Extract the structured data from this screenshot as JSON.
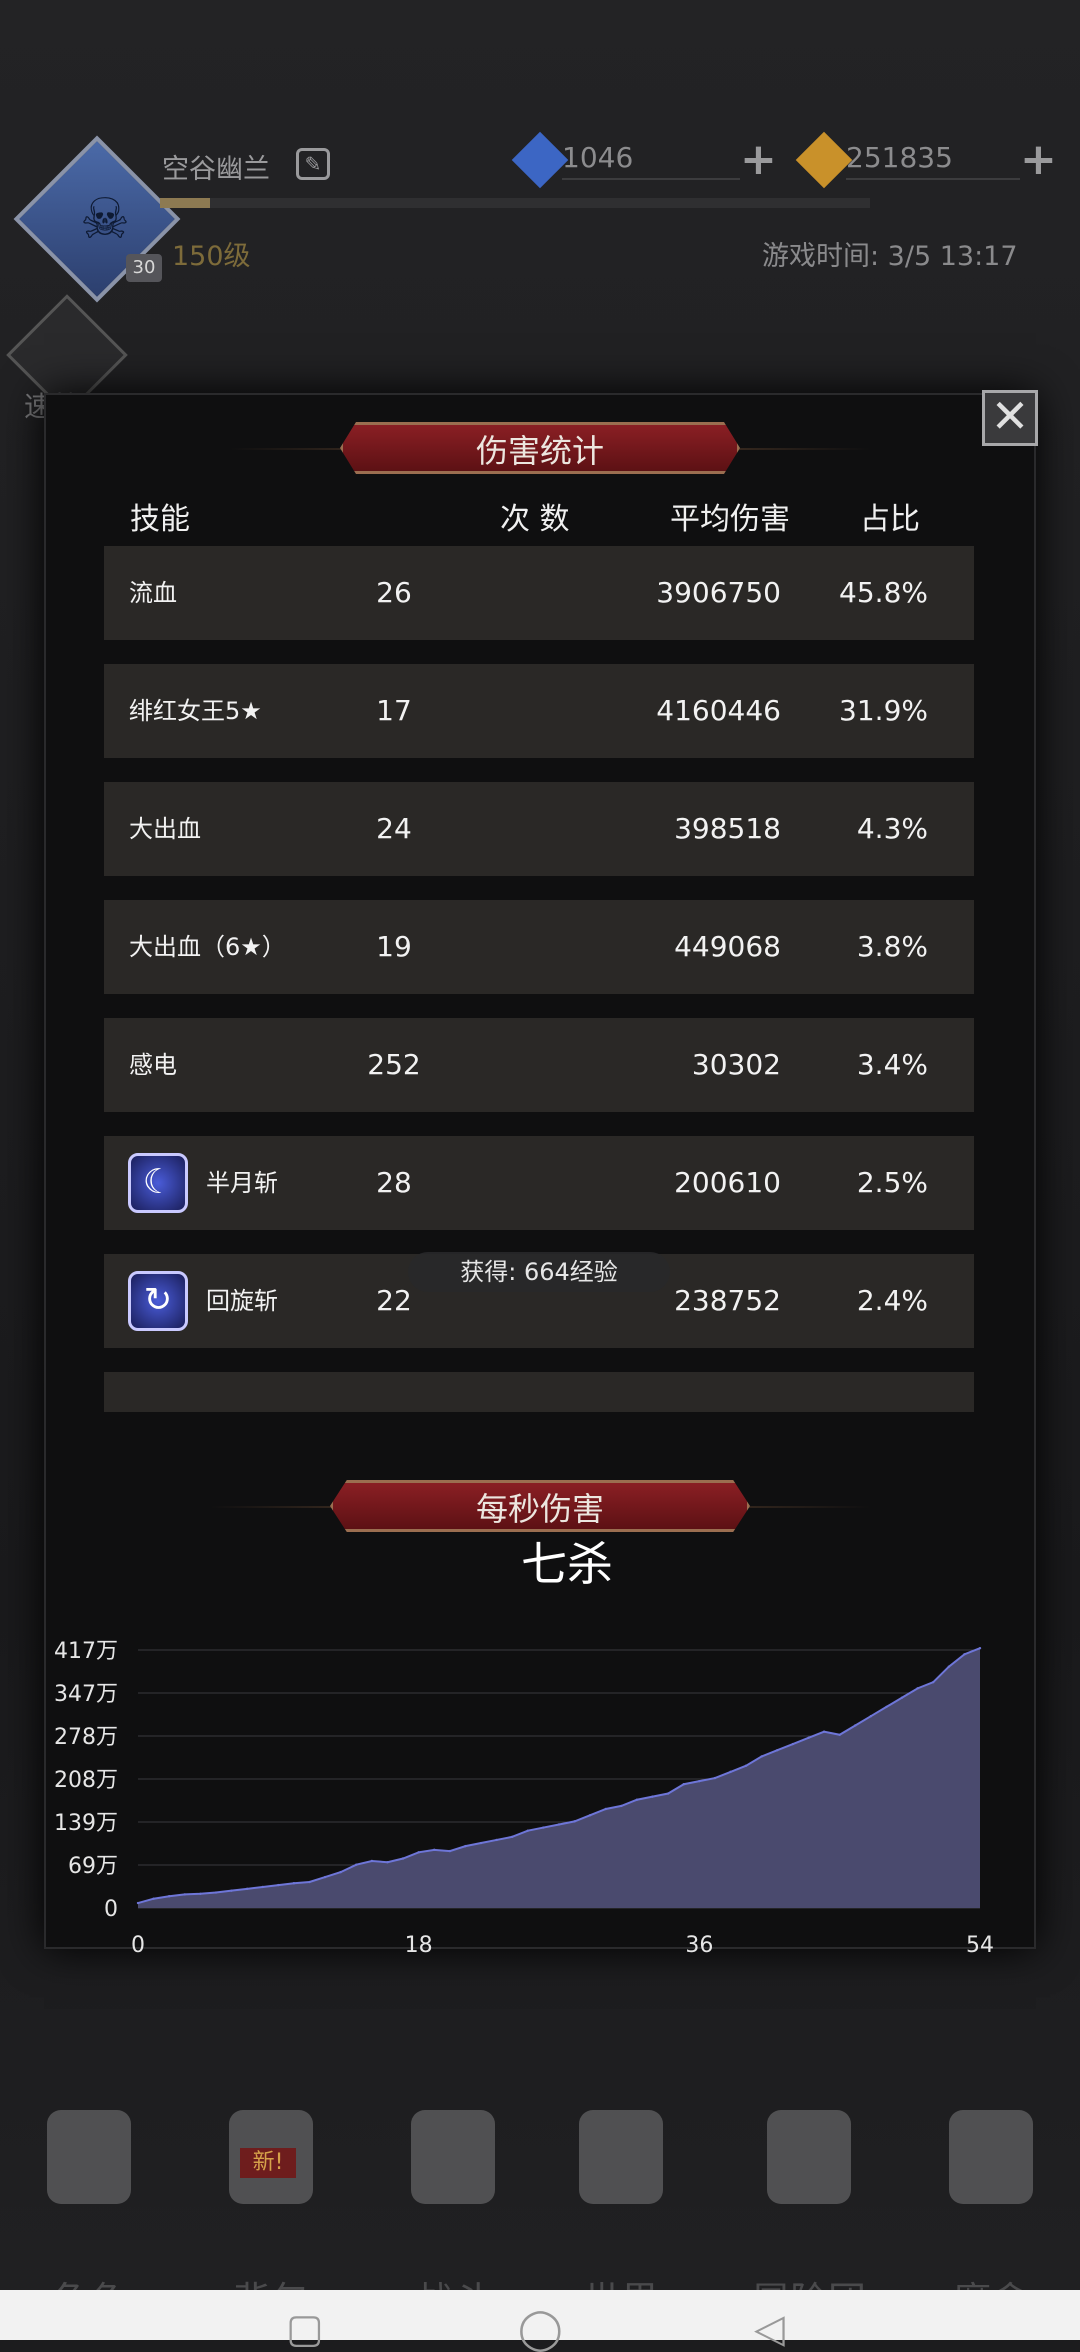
{
  "header": {
    "player_name": "空谷幽兰",
    "player_level": "150级",
    "level_badge": "30",
    "exp_progress": 0.07,
    "gems": "1046",
    "gold": "251835",
    "game_time": "游戏时间: 3/5 13:17",
    "side_label": "速战"
  },
  "modal": {
    "title": "伤害统计",
    "close_icon": "close-icon",
    "columns": {
      "skill": "技能",
      "count": "次 数",
      "avg_damage": "平均伤害",
      "ratio": "占比"
    },
    "rows": [
      {
        "skill": "流血",
        "count": "26",
        "avg": "3906750",
        "pct": "45.8%"
      },
      {
        "skill": "绯红女王5★",
        "count": "17",
        "avg": "4160446",
        "pct": "31.9%"
      },
      {
        "skill": "大出血",
        "count": "24",
        "avg": "398518",
        "pct": "4.3%"
      },
      {
        "skill": "大出血（6★）",
        "count": "19",
        "avg": "449068",
        "pct": "3.8%"
      },
      {
        "skill": "感电",
        "count": "252",
        "avg": "30302",
        "pct": "3.4%"
      },
      {
        "skill": "半月斩",
        "count": "28",
        "avg": "200610",
        "pct": "2.5%",
        "icon": "crescent-moon-icon"
      },
      {
        "skill": "回旋斩",
        "count": "22",
        "avg": "238752",
        "pct": "2.4%",
        "icon": "whirl-slash-icon"
      },
      {
        "skill": "",
        "count": "",
        "avg": "",
        "pct": ""
      }
    ],
    "exp_toast": "获得: 664经验",
    "dps_title": "每秒伤害",
    "chart_title": "七杀"
  },
  "chart_data": {
    "type": "area",
    "title": "七杀",
    "xlabel": "",
    "ylabel": "",
    "x_ticks": [
      "0",
      "18",
      "36",
      "54"
    ],
    "y_ticks": [
      "0",
      "69万",
      "139万",
      "208万",
      "278万",
      "347万",
      "417万"
    ],
    "xlim": [
      0,
      54
    ],
    "ylim": [
      0,
      4170000
    ],
    "color": "#4a4a6e",
    "line_color": "#6e76d8",
    "x": [
      0,
      1,
      2,
      3,
      4,
      5,
      6,
      7,
      8,
      9,
      10,
      11,
      12,
      13,
      14,
      15,
      16,
      17,
      18,
      19,
      20,
      21,
      22,
      23,
      24,
      25,
      26,
      27,
      28,
      29,
      30,
      31,
      32,
      33,
      34,
      35,
      36,
      37,
      38,
      39,
      40,
      41,
      42,
      43,
      44,
      45,
      46,
      47,
      48,
      49,
      50,
      51,
      52,
      53,
      54
    ],
    "y": [
      80000,
      150000,
      190000,
      220000,
      230000,
      250000,
      280000,
      310000,
      340000,
      370000,
      400000,
      420000,
      500000,
      580000,
      700000,
      760000,
      740000,
      800000,
      900000,
      940000,
      920000,
      1000000,
      1050000,
      1100000,
      1150000,
      1250000,
      1300000,
      1350000,
      1400000,
      1500000,
      1600000,
      1650000,
      1750000,
      1800000,
      1850000,
      2000000,
      2050000,
      2100000,
      2200000,
      2300000,
      2450000,
      2550000,
      2650000,
      2750000,
      2850000,
      2800000,
      2950000,
      3100000,
      3250000,
      3400000,
      3550000,
      3650000,
      3900000,
      4100000,
      4200000
    ]
  },
  "nav": {
    "items": [
      "角色",
      "背包",
      "战斗",
      "世界",
      "冒险团",
      "魔盒"
    ],
    "new_badge": "新!"
  }
}
